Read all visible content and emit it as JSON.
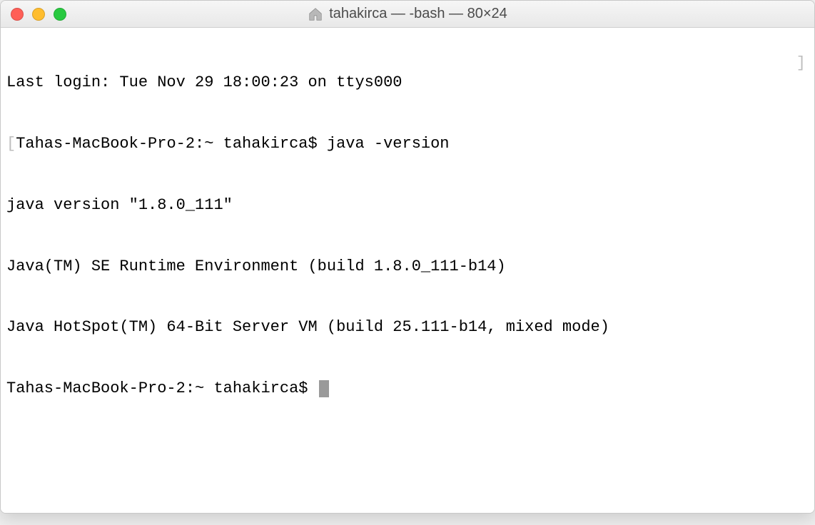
{
  "window": {
    "title": "tahakirca — -bash — 80×24"
  },
  "traffic_lights": {
    "close": "close",
    "minimize": "minimize",
    "maximize": "maximize"
  },
  "terminal": {
    "lines": {
      "last_login": "Last login: Tue Nov 29 18:00:23 on ttys000",
      "prompt1_left_bracket": "[",
      "prompt1": "Tahas-MacBook-Pro-2:~ tahakirca$ java -version",
      "prompt1_right_bracket": "]",
      "java_version": "java version \"1.8.0_111\"",
      "runtime": "Java(TM) SE Runtime Environment (build 1.8.0_111-b14)",
      "hotspot": "Java HotSpot(TM) 64-Bit Server VM (build 25.111-b14, mixed mode)",
      "prompt2": "Tahas-MacBook-Pro-2:~ tahakirca$ "
    }
  }
}
